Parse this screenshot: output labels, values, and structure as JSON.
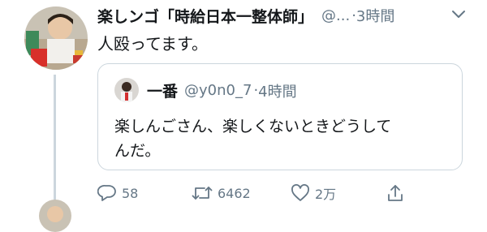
{
  "tweet": {
    "display_name": "楽しンゴ「時給日本一整体師」",
    "handle": "@...",
    "separator": "·",
    "time": "3時間",
    "text": "人殴ってます。"
  },
  "quoted": {
    "display_name": "一番",
    "handle": "@y0n0_7",
    "separator": "·",
    "time": "4時間",
    "text_line1": "楽しんごさん、楽しくないときどうして",
    "text_line2": "んだ。"
  },
  "actions": {
    "reply_count": "58",
    "retweet_count": "6462",
    "like_count": "2万"
  },
  "colors": {
    "text": "#14171a",
    "secondary": "#657786",
    "border": "#ccd6dd"
  },
  "icons": [
    "chevron-down-icon",
    "reply-icon",
    "retweet-icon",
    "like-icon",
    "share-icon"
  ]
}
